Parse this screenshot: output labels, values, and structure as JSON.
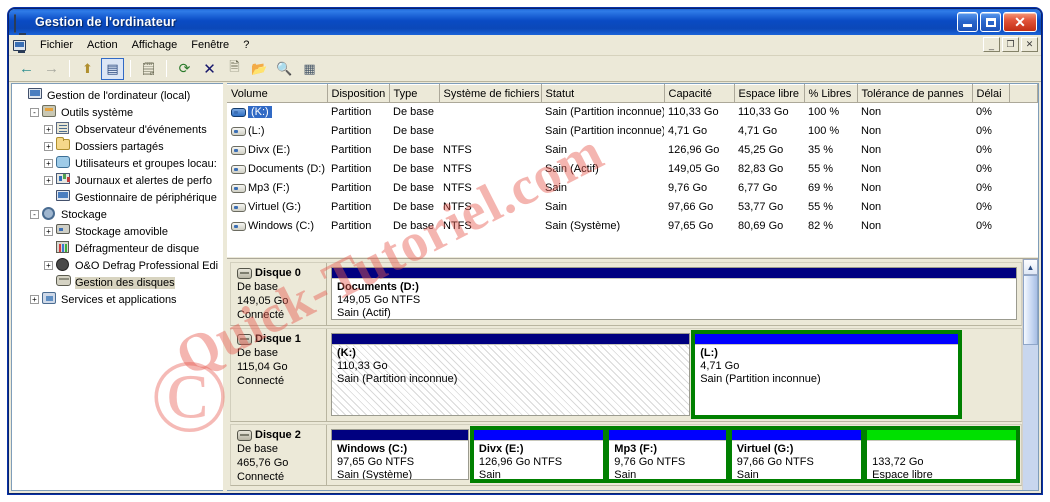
{
  "window": {
    "title": "Gestion de l'ordinateur",
    "title_icon": "monitor-icon",
    "minimize": "_",
    "maximize": "□",
    "close": "✕"
  },
  "menubar": {
    "icon": "monitor-icon",
    "items": [
      {
        "label": "Fichier"
      },
      {
        "label": "Action"
      },
      {
        "label": "Affichage"
      },
      {
        "label": "Fenêtre"
      },
      {
        "label": "?"
      }
    ],
    "inner_buttons": [
      {
        "name": "restore-down",
        "glyph": "_"
      },
      {
        "name": "maximize",
        "glyph": "❐"
      },
      {
        "name": "close",
        "glyph": "✕"
      }
    ]
  },
  "toolbar": {
    "buttons": [
      {
        "name": "back-arrow-icon",
        "glyph": "←"
      },
      {
        "name": "forward-arrow-icon",
        "glyph": "→"
      },
      {
        "name": "up-one-level-icon",
        "glyph": "⬆"
      },
      {
        "name": "show-hide-tree-icon",
        "glyph": "▤"
      },
      {
        "name": "properties-icon",
        "glyph": "🗒"
      },
      {
        "name": "refresh-icon",
        "glyph": "⟳"
      },
      {
        "name": "delete-icon",
        "glyph": "✕"
      },
      {
        "name": "export-list-icon",
        "glyph": "🗎"
      },
      {
        "name": "open-folder-icon",
        "glyph": "📂"
      },
      {
        "name": "search-icon",
        "glyph": "🔍"
      },
      {
        "name": "rescan-disks-icon",
        "glyph": "▦"
      }
    ]
  },
  "tree": {
    "root": {
      "label": "Gestion de l'ordinateur (local)",
      "icon": "computer-icon"
    },
    "items": [
      {
        "label": "Outils système",
        "icon": "tools-icon",
        "level": 1,
        "expander": "-"
      },
      {
        "label": "Observateur d'événements",
        "icon": "event-viewer-icon",
        "level": 2,
        "expander": "+"
      },
      {
        "label": "Dossiers partagés",
        "icon": "shared-folder-icon",
        "level": 2,
        "expander": "+"
      },
      {
        "label": "Utilisateurs et groupes locau:",
        "icon": "users-groups-icon",
        "level": 2,
        "expander": "+"
      },
      {
        "label": "Journaux et alertes de perfo",
        "icon": "performance-logs-icon",
        "level": 2,
        "expander": "+"
      },
      {
        "label": "Gestionnaire de périphérique",
        "icon": "device-manager-icon",
        "level": 2,
        "expander": ""
      },
      {
        "label": "Stockage",
        "icon": "storage-icon",
        "level": 1,
        "expander": "-"
      },
      {
        "label": "Stockage amovible",
        "icon": "removable-storage-icon",
        "level": 2,
        "expander": "+"
      },
      {
        "label": "Défragmenteur de disque",
        "icon": "defragmenter-icon",
        "level": 2,
        "expander": ""
      },
      {
        "label": "O&O Defrag Professional Edi",
        "icon": "oo-defrag-icon",
        "level": 2,
        "expander": "+"
      },
      {
        "label": "Gestion des disques",
        "icon": "disk-management-icon",
        "level": 2,
        "expander": "",
        "selected": true
      },
      {
        "label": "Services et applications",
        "icon": "services-icon",
        "level": 1,
        "expander": "+"
      }
    ]
  },
  "volume_list": {
    "columns": [
      "Volume",
      "Disposition",
      "Type",
      "Système de fichiers",
      "Statut",
      "Capacité",
      "Espace libre",
      "% Libres",
      "Tolérance de pannes",
      "Délai"
    ],
    "rows": [
      {
        "volume": "(K:)",
        "selected": true,
        "disposition": "Partition",
        "type": "De base",
        "fs": "",
        "status": "Sain (Partition inconnue)",
        "capacity": "110,33 Go",
        "free": "110,33 Go",
        "pct_free": "100 %",
        "fault_tolerance": "Non",
        "overhead": "0%"
      },
      {
        "volume": "(L:)",
        "selected": false,
        "disposition": "Partition",
        "type": "De base",
        "fs": "",
        "status": "Sain (Partition inconnue)",
        "capacity": "4,71 Go",
        "free": "4,71 Go",
        "pct_free": "100 %",
        "fault_tolerance": "Non",
        "overhead": "0%"
      },
      {
        "volume": "Divx (E:)",
        "selected": false,
        "disposition": "Partition",
        "type": "De base",
        "fs": "NTFS",
        "status": "Sain",
        "capacity": "126,96 Go",
        "free": "45,25 Go",
        "pct_free": "35 %",
        "fault_tolerance": "Non",
        "overhead": "0%"
      },
      {
        "volume": "Documents (D:)",
        "selected": false,
        "disposition": "Partition",
        "type": "De base",
        "fs": "NTFS",
        "status": "Sain (Actif)",
        "capacity": "149,05 Go",
        "free": "82,83 Go",
        "pct_free": "55 %",
        "fault_tolerance": "Non",
        "overhead": "0%"
      },
      {
        "volume": "Mp3 (F:)",
        "selected": false,
        "disposition": "Partition",
        "type": "De base",
        "fs": "NTFS",
        "status": "Sain",
        "capacity": "9,76 Go",
        "free": "6,77 Go",
        "pct_free": "69 %",
        "fault_tolerance": "Non",
        "overhead": "0%"
      },
      {
        "volume": "Virtuel (G:)",
        "selected": false,
        "disposition": "Partition",
        "type": "De base",
        "fs": "NTFS",
        "status": "Sain",
        "capacity": "97,66 Go",
        "free": "53,77 Go",
        "pct_free": "55 %",
        "fault_tolerance": "Non",
        "overhead": "0%"
      },
      {
        "volume": "Windows (C:)",
        "selected": false,
        "disposition": "Partition",
        "type": "De base",
        "fs": "NTFS",
        "status": "Sain (Système)",
        "capacity": "97,65 Go",
        "free": "80,69 Go",
        "pct_free": "82 %",
        "fault_tolerance": "Non",
        "overhead": "0%"
      }
    ]
  },
  "disk_pane": {
    "disks": [
      {
        "name": "Disque 0",
        "kind": "De base",
        "size": "149,05 Go",
        "state": "Connecté",
        "partitions": [
          {
            "name": "Documents  (D:)",
            "size_fs": "149,05 Go NTFS",
            "status": "Sain (Actif)",
            "bar_color": "#000080",
            "selected": false,
            "hatched": false,
            "flex": 100
          }
        ]
      },
      {
        "name": "Disque 1",
        "kind": "De base",
        "size": "115,04 Go",
        "state": "Connecté",
        "partitions": [
          {
            "name": "(K:)",
            "size_fs": "110,33 Go",
            "status": "Sain (Partition inconnue)",
            "bar_color": "#000080",
            "selected": false,
            "hatched": true,
            "flex": 53
          },
          {
            "name": "(L:)",
            "size_fs": "4,71 Go",
            "status": "Sain (Partition inconnue)",
            "bar_color": "#0000ff",
            "selected": true,
            "hatched": false,
            "flex": 39
          }
        ]
      },
      {
        "name": "Disque 2",
        "kind": "De base",
        "size": "465,76 Go",
        "state": "Connecté",
        "partitions": [
          {
            "name": "Windows  (C:)",
            "size_fs": "97,65 Go NTFS",
            "status": "Sain (Système)",
            "bar_color": "#000080",
            "selected": false,
            "hatched": false,
            "flex": 21
          },
          {
            "name": "Divx  (E:)",
            "size_fs": "126,96 Go NTFS",
            "status": "Sain",
            "bar_color": "#0000ff",
            "selected": true,
            "hatched": false,
            "flex": 20
          },
          {
            "name": "Mp3  (F:)",
            "size_fs": "9,76 Go NTFS",
            "status": "Sain",
            "bar_color": "#0000ff",
            "selected": true,
            "hatched": false,
            "flex": 18
          },
          {
            "name": "Virtuel  (G:)",
            "size_fs": "97,66 Go NTFS",
            "status": "Sain",
            "bar_color": "#0000ff",
            "selected": true,
            "hatched": false,
            "flex": 20
          },
          {
            "name": "",
            "size_fs": "133,72 Go",
            "status": "Espace libre",
            "bar_color": "#00e000",
            "selected": true,
            "hatched": false,
            "flex": 23
          }
        ]
      }
    ],
    "scrollbar": {
      "up": "▲",
      "down": "▼"
    }
  },
  "watermark": {
    "text": "Quick-Tutoriel.com",
    "symbol": "©",
    "color": "#e65a50"
  }
}
